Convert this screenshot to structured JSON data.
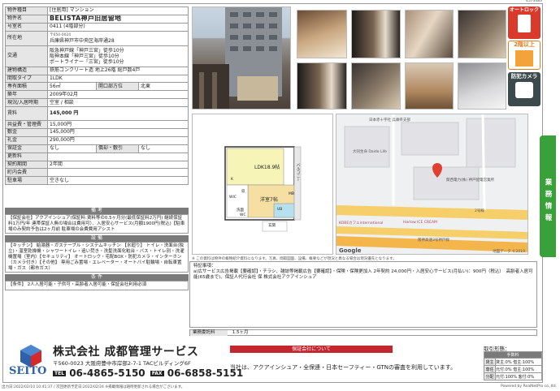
{
  "ref_id": "4573483",
  "spec": [
    {
      "k": "物件種目",
      "v": "[住居用] マンション"
    },
    {
      "k": "物件名",
      "v": "BELISTA神戸旧居留地"
    },
    {
      "k": "号室名",
      "v": "0411 (4階部分)"
    },
    {
      "k": "所在地",
      "v": "〒650-0024",
      "v2": "兵庫県神戸市中央区海岸通28"
    },
    {
      "k": "交通",
      "v": "阪急神戸線「神戸三宮」徒歩10分",
      "v2": "阪神本線「神戸三宮」徒歩10分",
      "v3": "ポートライナー「三宮」徒歩10分"
    },
    {
      "k": "建物構造",
      "v": "鉄筋コンクリート造 地上26階 総戸数4戸"
    },
    {
      "k": "間取タイプ",
      "v": "1LDK"
    },
    {
      "k": "専有面積",
      "v": "56㎡",
      "k2": "開口部方位",
      "v2": "北東"
    },
    {
      "k": "築年",
      "v": "2009年02月"
    },
    {
      "k": "現況/入居時期",
      "v": "空室 / 相談"
    },
    {
      "k": "賃料",
      "v": "145,000 円"
    },
    {
      "k": "共益費・管理費",
      "v": "15,000円"
    },
    {
      "k": "敷金",
      "v": "145,000円"
    },
    {
      "k": "礼金",
      "v": "290,000円"
    },
    {
      "k": "保証金",
      "v": "なし",
      "k2": "償却・敷引",
      "v2": "なし"
    },
    {
      "k": "更新料",
      "v": ""
    },
    {
      "k": "契約期間",
      "v": "2年間"
    },
    {
      "k": "町内会費",
      "v": ""
    },
    {
      "k": "駐車場",
      "v": "空きなし"
    }
  ],
  "sections": {
    "notes_title": "備 考",
    "notes_text": "【保証会社】アクアインシュア(保証料:賃料等の0.5ヶ月分(最低保証料2万円) 継続保証料1万円/年 連帯保証人無の場合は費用可）、入居安心サービス(月額1900円(税込)【駐車場のみ契約予告は2ヶ月前 駐車場の会費費用アシスト",
    "facilities_title": "設 備",
    "facilities_text": "【キッチン】 給湯器・ガステーブル・システムキッチン 【水廻り】 トイレ・洗面台(独立)・温室乾燥機・シャワートイレ・追い焚き・洗髪洗面化粧台・バス・トイレ別・洗濯機置場（室内）【セキュリティ】 オートロック・宅配BOX・防犯カメラ・インターホン（カメラ付き）【その他】 専用ごみ置場・エレベーター・オートバイ駐輪場・自転車置場・ガス（都市ガス）",
    "conditions_title": "条 件",
    "conditions_text": "【条件】 2人入居可能・子供可・高齢者入居可能・保証会社利用必須"
  },
  "badges": {
    "autolock": "オートロック",
    "floor": "2階以上",
    "camera": "防犯カメラ"
  },
  "side_tab": "業務情報",
  "floorplan": {
    "ldk": "LDK18.9帖",
    "western": "洋室7帖",
    "entrance": "玄関",
    "balcony": "バルコニー",
    "wic": "WIC",
    "ub": "UB",
    "wash": "洗面",
    "wc": "WC",
    "kitchen": "K",
    "mb": "MB",
    "storage": "収"
  },
  "map": {
    "label1": "日本赤十字社 兵庫県支部",
    "label2": "大同生命 Daido Life",
    "label3": "関西電力(株) 神戸配電営業所",
    "label4": "KOBEカフェinternational",
    "label5": "Harlow ICE CREAM",
    "label6": "2号線",
    "label7": "阪神高速3号神戸線",
    "label8": "Google",
    "copyright": "地図データ ©2019"
  },
  "disclaimer": "※ この資料は物件の概略紹介資料になります。写真、間取図面、設備、概要などが現況と異なる場合は現況優先となります。",
  "remarks": {
    "title": "特記事項：",
    "text": "a)広サービス広告掲載【要確認】・チラシ、雑誌等掲載広告【要確認】・保険・保険更加入 2年契約 24,000円・入居安心サービス(月払い)：900円（税込）　高齢者入居可能(65歳まで)、保証人代行会社 保 株式会社アクアインシュア"
  },
  "fee_label": "業務委託料",
  "fee_value": "1.5ヶ月",
  "company": {
    "name": "株式会社 成都管理サービス",
    "logo_text": "SEITO",
    "postal": "〒560-0023",
    "address": "大阪府豊中市岸部2-7-1 TACビルディング6F",
    "tel_label": "TEL",
    "tel": "06-4865-5150",
    "fax_label": "FAX",
    "fax": "06-6858-5151"
  },
  "guarantee": {
    "title": "保証会社について",
    "text": "当社は、アクアインシュア・全保連・日本セーフティー・GTNの審査を利用しています。"
  },
  "transaction": {
    "title": "取引形態：",
    "fee_header": "手数料",
    "rows": [
      {
        "label": "貸主",
        "value": "貸主:0% 借主:100%"
      },
      {
        "label": "専任",
        "value": "元付:0% 借主:100%"
      },
      {
        "label": "分配",
        "value": "元付:100% 客付:0%"
      }
    ]
  },
  "footer_left": "出力日:2022/02/10 10:41:37 / 次回更新予定日:2022/02/24 ※掲載情報は随時更新される場合がございます。",
  "footer_right": "Powered by RealNetPro co.,ltd."
}
